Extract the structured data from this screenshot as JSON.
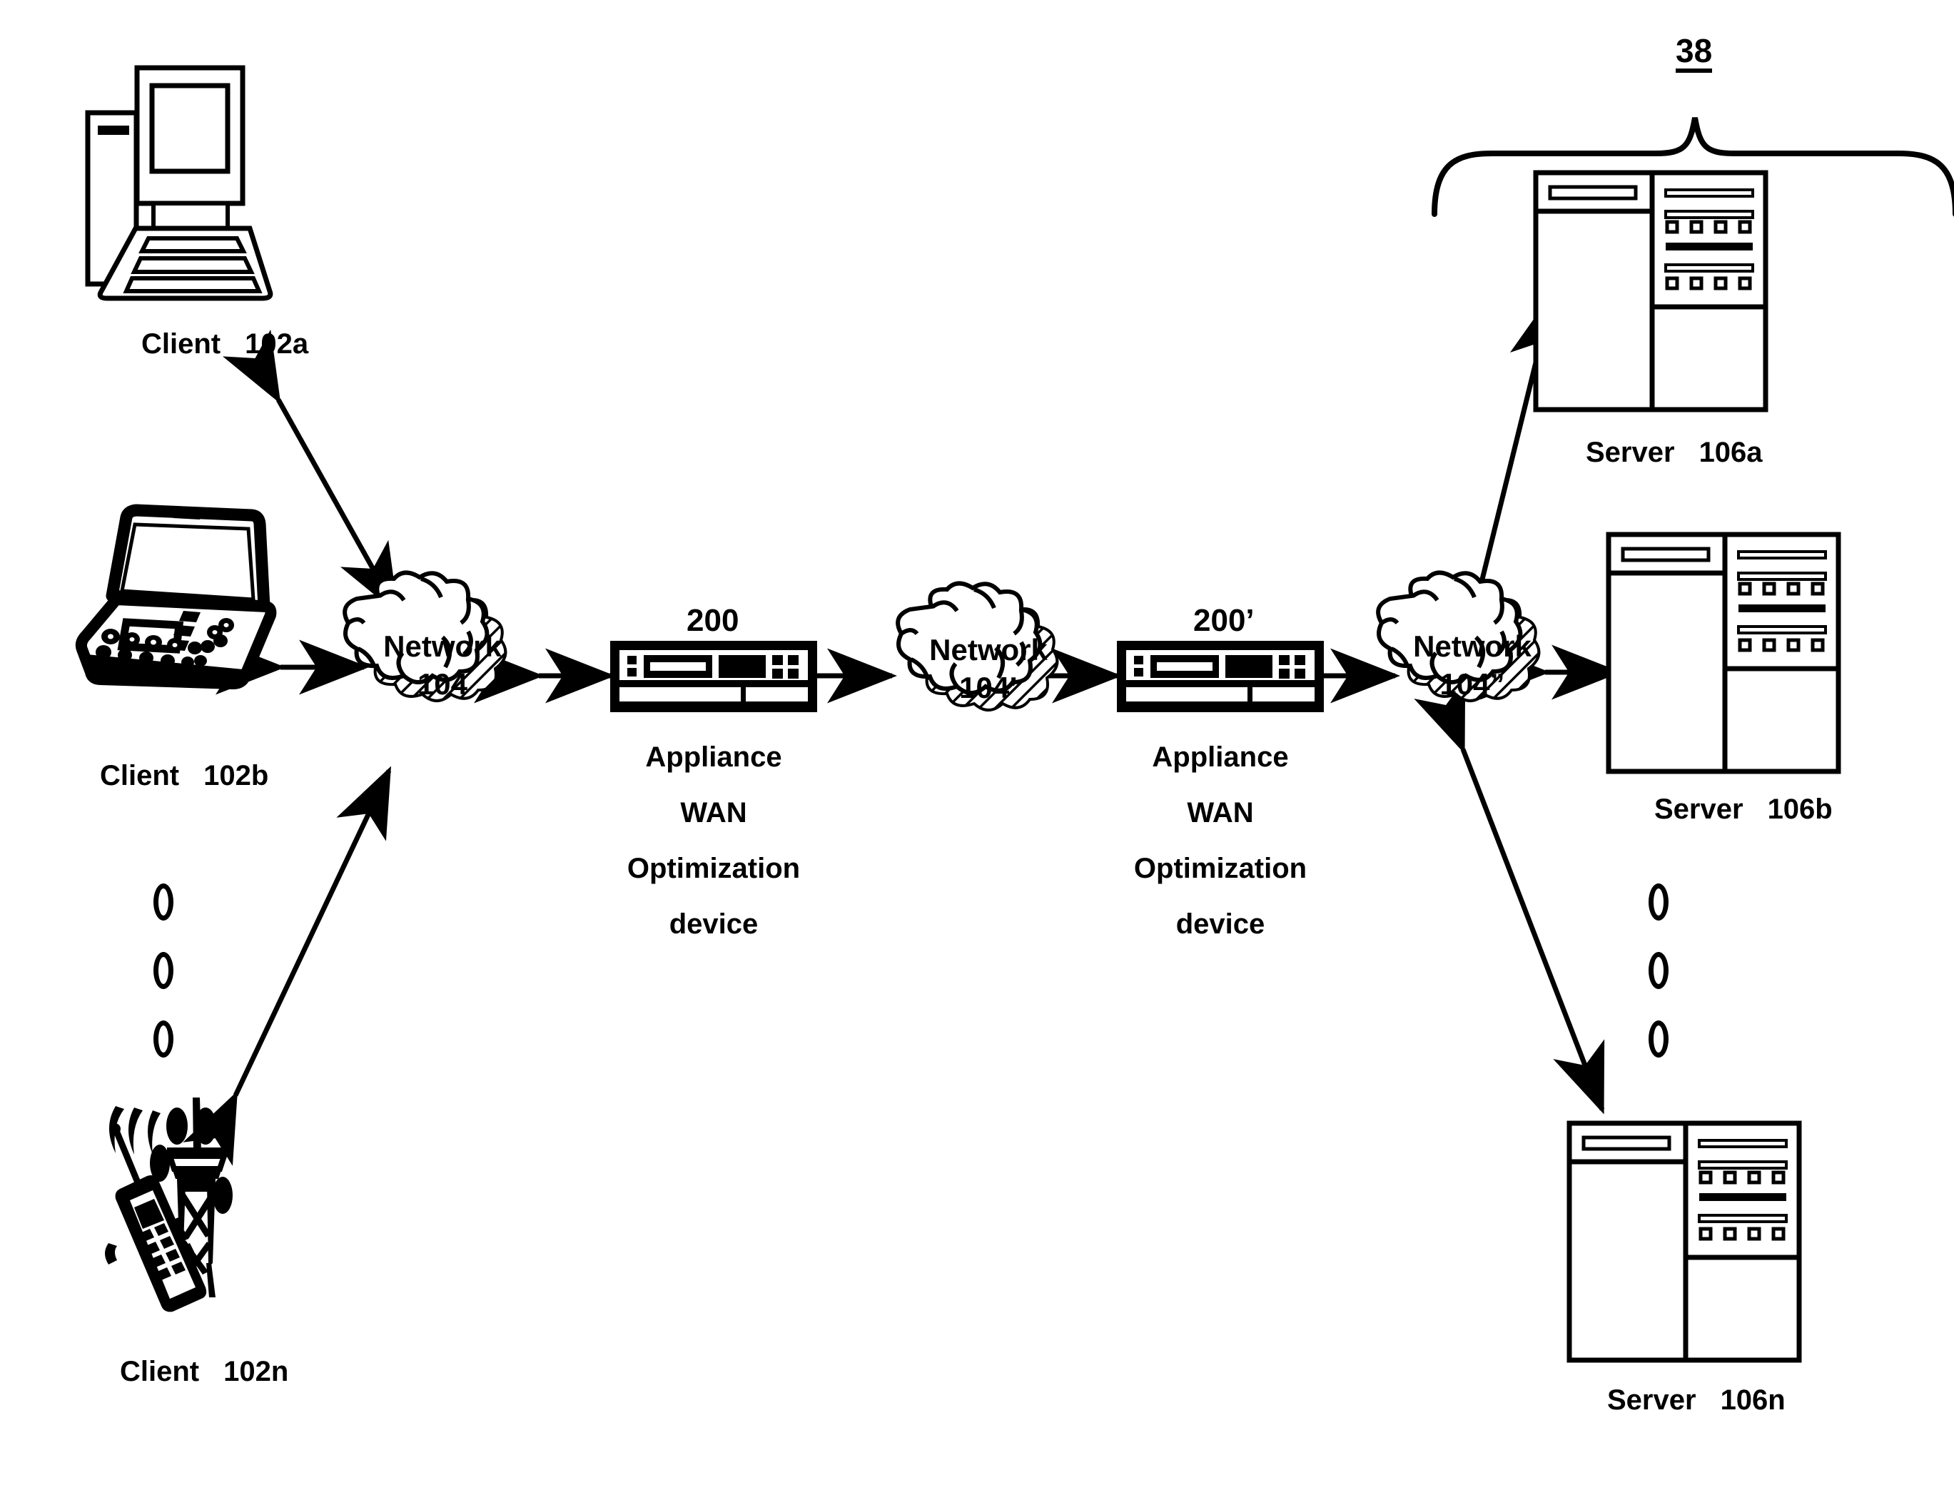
{
  "figure": {
    "group_label": "38"
  },
  "clients": [
    {
      "caption": "Client",
      "ref": "102a",
      "icon": "desktop-computer-icon"
    },
    {
      "caption": "Client",
      "ref": "102b",
      "icon": "laptop-computer-icon"
    },
    {
      "caption": "Client",
      "ref": "102n",
      "icon": "mobile-phone-tower-icon"
    }
  ],
  "networks": [
    {
      "line1": "Network",
      "line2": "104",
      "icon": "network-cloud-icon"
    },
    {
      "line1": "Network",
      "line2": "104’",
      "icon": "network-cloud-icon"
    },
    {
      "line1": "Network",
      "line2": "104”",
      "icon": "network-cloud-icon"
    }
  ],
  "appliances": [
    {
      "number": "200",
      "line1": "Appliance",
      "line2": "WAN",
      "line3": "Optimization",
      "line4": "device",
      "icon": "appliance-device-icon"
    },
    {
      "number": "200’",
      "line1": "Appliance",
      "line2": "WAN",
      "line3": "Optimization",
      "line4": "device",
      "icon": "appliance-device-icon"
    }
  ],
  "servers": [
    {
      "caption": "Server",
      "ref": "106a",
      "icon": "server-rack-icon"
    },
    {
      "caption": "Server",
      "ref": "106b",
      "icon": "server-rack-icon"
    },
    {
      "caption": "Server",
      "ref": "106n",
      "icon": "server-rack-icon"
    }
  ],
  "ellipses": {
    "clients_dots": "vertical-ellipsis",
    "servers_dots": "vertical-ellipsis"
  },
  "colors": {
    "stroke": "#000000",
    "fill": "#ffffff",
    "background": "#ffffff"
  }
}
